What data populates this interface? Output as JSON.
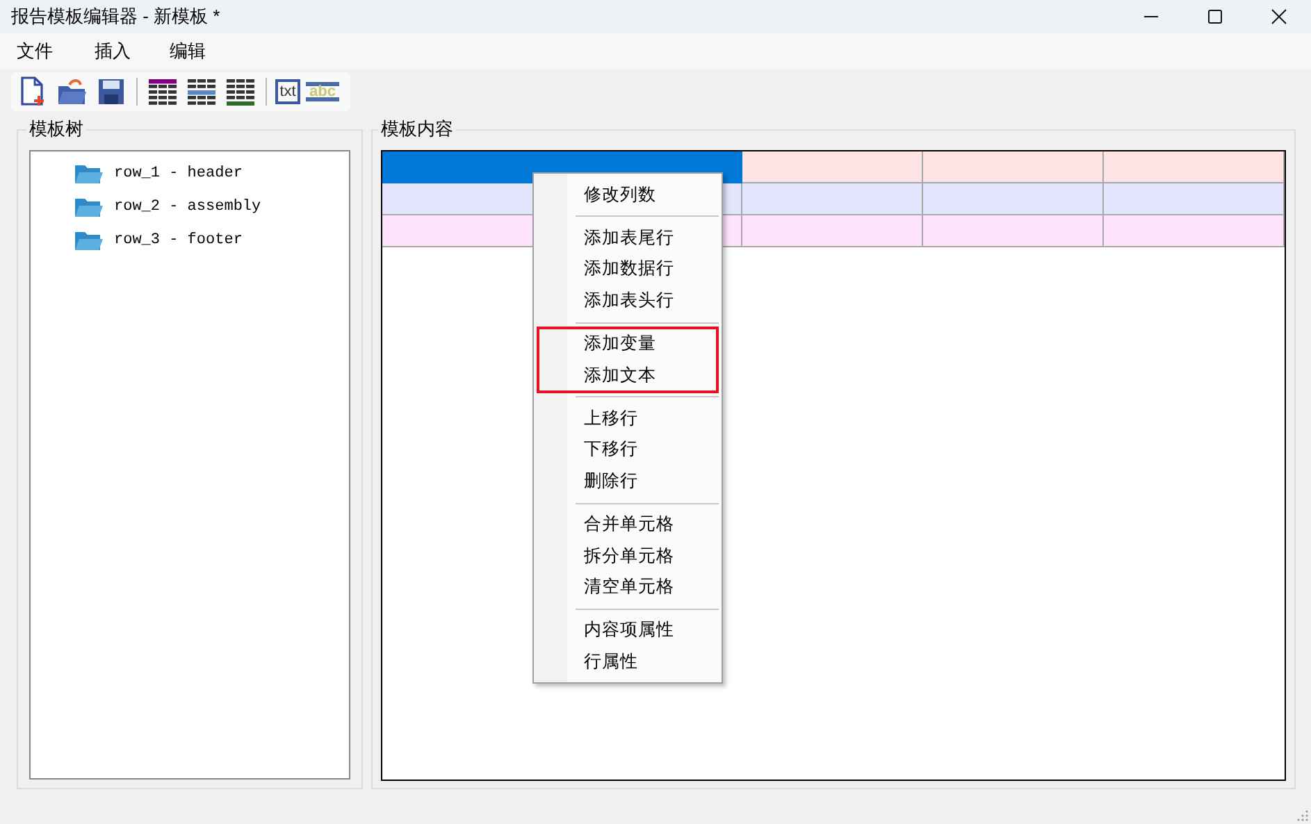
{
  "window": {
    "title": "报告模板编辑器 - 新模板 *"
  },
  "menu_bar": [
    {
      "label": "文件"
    },
    {
      "label": "插入"
    },
    {
      "label": "编辑"
    }
  ],
  "toolbar": [
    {
      "kind": "new"
    },
    {
      "kind": "open"
    },
    {
      "kind": "save"
    },
    {
      "kind": "separator"
    },
    {
      "kind": "header-table"
    },
    {
      "kind": "data-table"
    },
    {
      "kind": "footer-table"
    },
    {
      "kind": "separator"
    },
    {
      "kind": "text",
      "label": "txt"
    },
    {
      "kind": "variable",
      "label": "abc"
    }
  ],
  "tree_panel": {
    "title": "模板树",
    "items": [
      {
        "label": "row_1 - header"
      },
      {
        "label": "row_2 - assembly"
      },
      {
        "label": "row_3 - footer"
      }
    ]
  },
  "content_panel": {
    "title": "模板内容",
    "rows": [
      {
        "color": "#fee4e4",
        "cells": [
          {
            "selected": true
          },
          {
            "selected": false
          },
          {
            "selected": false
          },
          {
            "selected": false
          }
        ]
      },
      {
        "color": "#e4e4fc",
        "cells": [
          {
            "selected": false
          },
          {
            "selected": false
          },
          {
            "selected": false
          },
          {
            "selected": false
          }
        ]
      },
      {
        "color": "#fde4fc",
        "cells": [
          {
            "selected": false
          },
          {
            "selected": false
          },
          {
            "selected": false
          },
          {
            "selected": false
          }
        ]
      }
    ]
  },
  "context_menu": {
    "sections": [
      {
        "highlighted": false,
        "items": [
          "修改列数"
        ]
      },
      {
        "highlighted": false,
        "items": [
          "添加表尾行",
          "添加数据行",
          "添加表头行"
        ]
      },
      {
        "highlighted": true,
        "items": [
          "添加变量",
          "添加文本"
        ]
      },
      {
        "highlighted": false,
        "items": [
          "上移行",
          "下移行",
          "删除行"
        ]
      },
      {
        "highlighted": false,
        "items": [
          "合并单元格",
          "拆分单元格",
          "清空单元格"
        ]
      },
      {
        "highlighted": false,
        "items": [
          "内容项属性",
          "行属性"
        ]
      }
    ]
  }
}
